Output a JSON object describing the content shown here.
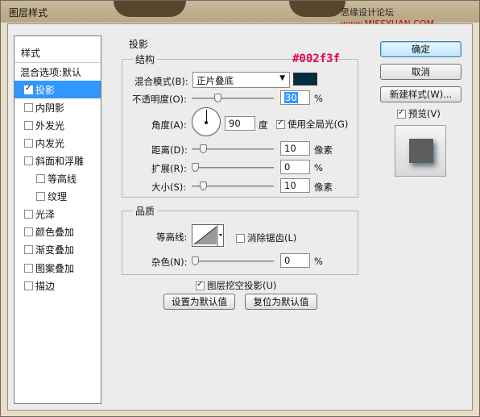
{
  "window": {
    "title": "图层样式",
    "watermark_prefix": "思缘设计论坛  ",
    "watermark_url": "www.MISSYUAN.COM"
  },
  "styles_list": {
    "header": "样式",
    "items": [
      {
        "label": "混合选项:默认",
        "checkbox": false,
        "checked": false,
        "selected": false,
        "indent": 0
      },
      {
        "label": "投影",
        "checkbox": true,
        "checked": true,
        "selected": true,
        "indent": 0
      },
      {
        "label": "内阴影",
        "checkbox": true,
        "checked": false,
        "selected": false,
        "indent": 0
      },
      {
        "label": "外发光",
        "checkbox": true,
        "checked": false,
        "selected": false,
        "indent": 0
      },
      {
        "label": "内发光",
        "checkbox": true,
        "checked": false,
        "selected": false,
        "indent": 0
      },
      {
        "label": "斜面和浮雕",
        "checkbox": true,
        "checked": false,
        "selected": false,
        "indent": 0
      },
      {
        "label": "等高线",
        "checkbox": true,
        "checked": false,
        "selected": false,
        "indent": 1
      },
      {
        "label": "纹理",
        "checkbox": true,
        "checked": false,
        "selected": false,
        "indent": 1
      },
      {
        "label": "光泽",
        "checkbox": true,
        "checked": false,
        "selected": false,
        "indent": 0
      },
      {
        "label": "颜色叠加",
        "checkbox": true,
        "checked": false,
        "selected": false,
        "indent": 0
      },
      {
        "label": "渐变叠加",
        "checkbox": true,
        "checked": false,
        "selected": false,
        "indent": 0
      },
      {
        "label": "图案叠加",
        "checkbox": true,
        "checked": false,
        "selected": false,
        "indent": 0
      },
      {
        "label": "描边",
        "checkbox": true,
        "checked": false,
        "selected": false,
        "indent": 0
      }
    ]
  },
  "drop_shadow": {
    "section_title": "投影",
    "structure_title": "结构",
    "blend_mode_label": "混合模式(B):",
    "blend_mode_value": "正片叠底",
    "shadow_color": "#002f3f",
    "color_annotation": "#002f3f",
    "opacity_label": "不透明度(O):",
    "opacity_value": "30",
    "opacity_unit": "%",
    "angle_label": "角度(A):",
    "angle_value": "90",
    "angle_unit": "度",
    "global_light_label": "使用全局光(G)",
    "global_light_checked": true,
    "distance_label": "距离(D):",
    "distance_value": "10",
    "distance_unit": "像素",
    "spread_label": "扩展(R):",
    "spread_value": "0",
    "spread_unit": "%",
    "size_label": "大小(S):",
    "size_value": "10",
    "size_unit": "像素",
    "quality_title": "品质",
    "contour_label": "等高线:",
    "anti_alias_label": "消除锯齿(L)",
    "anti_alias_checked": false,
    "noise_label": "杂色(N):",
    "noise_value": "0",
    "noise_unit": "%",
    "knockout_label": "图层挖空投影(U)",
    "knockout_checked": true,
    "make_default_label": "设置为默认值",
    "reset_default_label": "复位为默认值"
  },
  "right_panel": {
    "ok_label": "确定",
    "cancel_label": "取消",
    "new_style_label": "新建样式(W)...",
    "preview_label": "预览(V)",
    "preview_checked": true
  }
}
